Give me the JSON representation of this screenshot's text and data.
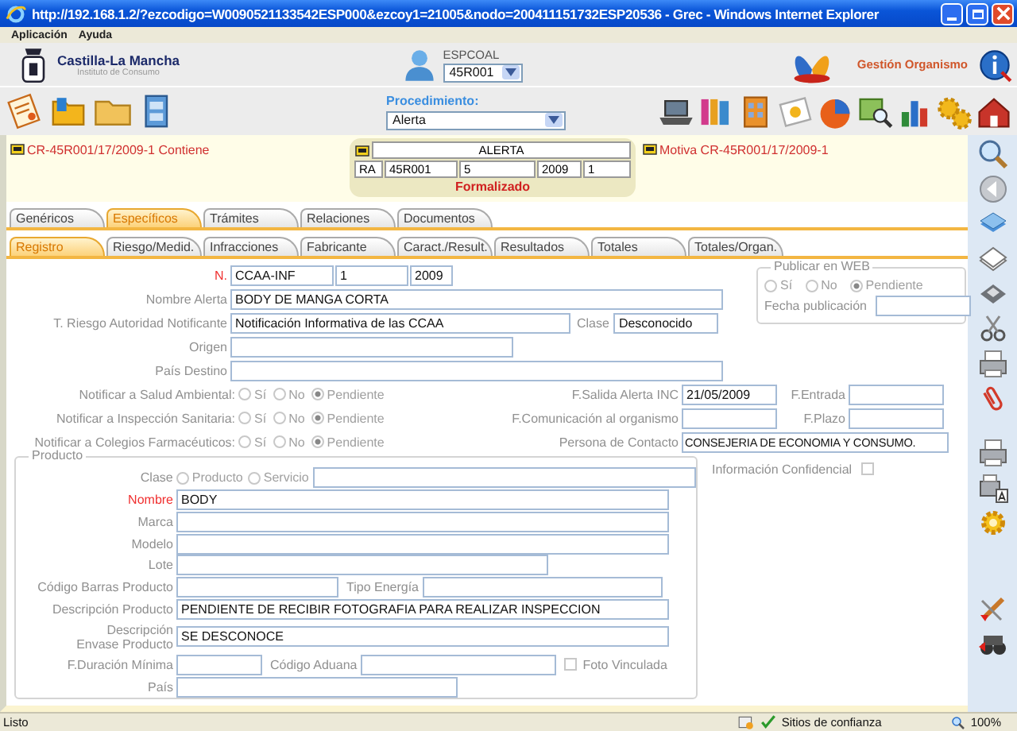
{
  "window": {
    "title": "http://192.168.1.2/?ezcodigo=W0090521133542ESP000&ezcoy1=21005&nodo=200411151732ESP20536 - Grec - Windows Internet Explorer"
  },
  "menu": [
    "Aplicación",
    "Ayuda"
  ],
  "header": {
    "org_name": "Castilla-La Mancha",
    "org_subtitle": "Instituto de Consumo",
    "user_label": "ESPCOAL",
    "user_select": "45R001",
    "section_link": "Gestión Organismo"
  },
  "toolbar": {
    "procedure_label": "Procedimiento:",
    "procedure_value": "Alerta"
  },
  "alert_bar": {
    "left_link": "CR-45R001/17/2009-1 Contiene",
    "right_link": "Motiva CR-45R001/17/2009-1",
    "title": "ALERTA",
    "codes": [
      "RA",
      "45R001",
      "5",
      "2009",
      "1"
    ],
    "status": "Formalizado"
  },
  "tabs": [
    {
      "label": "Genéricos",
      "selected": false
    },
    {
      "label": "Específicos",
      "selected": true
    },
    {
      "label": "Trámites",
      "selected": false
    },
    {
      "label": "Relaciones",
      "selected": false
    },
    {
      "label": "Documentos",
      "selected": false
    }
  ],
  "subtabs": [
    {
      "label": "Registro",
      "selected": true
    },
    {
      "label": "Riesgo/Medid.",
      "selected": false
    },
    {
      "label": "Infracciones",
      "selected": false
    },
    {
      "label": "Fabricante",
      "selected": false
    },
    {
      "label": "Caract./Result.",
      "selected": false
    },
    {
      "label": "Resultados",
      "selected": false
    },
    {
      "label": "Totales",
      "selected": false
    },
    {
      "label": "Totales/Organ.",
      "selected": false
    }
  ],
  "form": {
    "number": {
      "label": "N.",
      "required": true,
      "values": [
        "CCAA-INF",
        "1",
        "2009"
      ]
    },
    "alert_name": {
      "label": "Nombre Alerta",
      "value": "BODY DE MANGA CORTA"
    },
    "risk": {
      "label": "T. Riesgo Autoridad Notificante",
      "value": "Notificación Informativa de las CCAA"
    },
    "class": {
      "label": "Clase",
      "value": "Desconocido"
    },
    "origin": {
      "label": "Origen"
    },
    "destination": {
      "label": "País Destino"
    },
    "publish": {
      "legend": "Publicar en WEB",
      "date_label": "Fecha publicación",
      "options": [
        {
          "label": "Sí",
          "selected": false
        },
        {
          "label": "No",
          "selected": false
        },
        {
          "label": "Pendiente",
          "selected": true
        }
      ]
    },
    "notify": [
      {
        "label": "Notificar a Salud Ambiental:",
        "options": [
          {
            "label": "Sí",
            "selected": false
          },
          {
            "label": "No",
            "selected": false
          },
          {
            "label": "Pendiente",
            "selected": true
          }
        ]
      },
      {
        "label": "Notificar a Inspección Sanitaria:",
        "options": [
          {
            "label": "Sí",
            "selected": false
          },
          {
            "label": "No",
            "selected": false
          },
          {
            "label": "Pendiente",
            "selected": true
          }
        ]
      },
      {
        "label": "Notificar a Colegios Farmacéuticos:",
        "options": [
          {
            "label": "Sí",
            "selected": false
          },
          {
            "label": "No",
            "selected": false
          },
          {
            "label": "Pendiente",
            "selected": true
          }
        ]
      }
    ],
    "dates": [
      {
        "label": "F.Salida Alerta INC",
        "value": "21/05/2009"
      },
      {
        "label": "F.Entrada"
      },
      {
        "label": "F.Comunicación al organismo"
      },
      {
        "label": "F.Plazo"
      }
    ],
    "contact": {
      "label": "Persona de Contacto",
      "value": "CONSEJERIA DE ECONOMIA Y CONSUMO."
    },
    "confidential": {
      "label": "Información Confidencial",
      "checked": false
    },
    "product": {
      "legend": "Producto",
      "class_label": "Clase",
      "class_options": [
        {
          "label": "Producto",
          "selected": false
        },
        {
          "label": "Servicio",
          "selected": false
        }
      ],
      "name": {
        "label": "Nombre",
        "required": true,
        "value": "BODY"
      },
      "brand": {
        "label": "Marca"
      },
      "model": {
        "label": "Modelo"
      },
      "lot": {
        "label": "Lote"
      },
      "barcode": {
        "label": "Código Barras Producto"
      },
      "energy": {
        "label": "Tipo Energía"
      },
      "description": {
        "label": "Descripción Producto",
        "value": "PENDIENTE DE RECIBIR FOTOGRAFIA PARA REALIZAR INSPECCION"
      },
      "packaging": {
        "label": "Descripción Envase Producto",
        "value": "SE DESCONOCE"
      },
      "min_duration": {
        "label": "F.Duración Mínima"
      },
      "customs": {
        "label": "Código Aduana"
      },
      "photo": {
        "label": "Foto Vinculada",
        "checked": false
      },
      "country": {
        "label": "País"
      }
    }
  },
  "status_bar": {
    "text": "Listo",
    "zone": "Sitios de confianza",
    "zoom": "100%"
  }
}
